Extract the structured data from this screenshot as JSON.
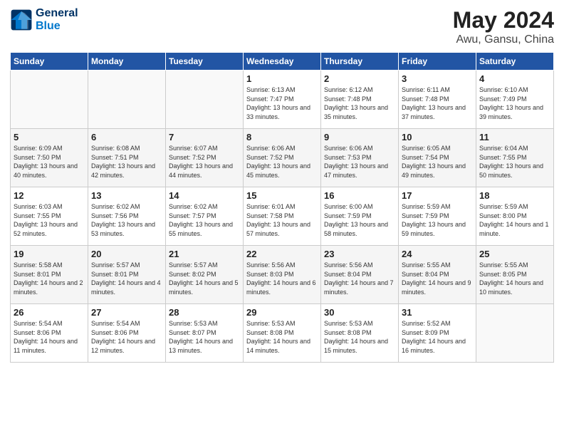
{
  "logo": {
    "line1": "General",
    "line2": "Blue"
  },
  "title": "May 2024",
  "subtitle": "Awu, Gansu, China",
  "days_of_week": [
    "Sunday",
    "Monday",
    "Tuesday",
    "Wednesday",
    "Thursday",
    "Friday",
    "Saturday"
  ],
  "weeks": [
    [
      {
        "num": "",
        "info": ""
      },
      {
        "num": "",
        "info": ""
      },
      {
        "num": "",
        "info": ""
      },
      {
        "num": "1",
        "info": "Sunrise: 6:13 AM\nSunset: 7:47 PM\nDaylight: 13 hours\nand 33 minutes."
      },
      {
        "num": "2",
        "info": "Sunrise: 6:12 AM\nSunset: 7:48 PM\nDaylight: 13 hours\nand 35 minutes."
      },
      {
        "num": "3",
        "info": "Sunrise: 6:11 AM\nSunset: 7:48 PM\nDaylight: 13 hours\nand 37 minutes."
      },
      {
        "num": "4",
        "info": "Sunrise: 6:10 AM\nSunset: 7:49 PM\nDaylight: 13 hours\nand 39 minutes."
      }
    ],
    [
      {
        "num": "5",
        "info": "Sunrise: 6:09 AM\nSunset: 7:50 PM\nDaylight: 13 hours\nand 40 minutes."
      },
      {
        "num": "6",
        "info": "Sunrise: 6:08 AM\nSunset: 7:51 PM\nDaylight: 13 hours\nand 42 minutes."
      },
      {
        "num": "7",
        "info": "Sunrise: 6:07 AM\nSunset: 7:52 PM\nDaylight: 13 hours\nand 44 minutes."
      },
      {
        "num": "8",
        "info": "Sunrise: 6:06 AM\nSunset: 7:52 PM\nDaylight: 13 hours\nand 45 minutes."
      },
      {
        "num": "9",
        "info": "Sunrise: 6:06 AM\nSunset: 7:53 PM\nDaylight: 13 hours\nand 47 minutes."
      },
      {
        "num": "10",
        "info": "Sunrise: 6:05 AM\nSunset: 7:54 PM\nDaylight: 13 hours\nand 49 minutes."
      },
      {
        "num": "11",
        "info": "Sunrise: 6:04 AM\nSunset: 7:55 PM\nDaylight: 13 hours\nand 50 minutes."
      }
    ],
    [
      {
        "num": "12",
        "info": "Sunrise: 6:03 AM\nSunset: 7:55 PM\nDaylight: 13 hours\nand 52 minutes."
      },
      {
        "num": "13",
        "info": "Sunrise: 6:02 AM\nSunset: 7:56 PM\nDaylight: 13 hours\nand 53 minutes."
      },
      {
        "num": "14",
        "info": "Sunrise: 6:02 AM\nSunset: 7:57 PM\nDaylight: 13 hours\nand 55 minutes."
      },
      {
        "num": "15",
        "info": "Sunrise: 6:01 AM\nSunset: 7:58 PM\nDaylight: 13 hours\nand 57 minutes."
      },
      {
        "num": "16",
        "info": "Sunrise: 6:00 AM\nSunset: 7:59 PM\nDaylight: 13 hours\nand 58 minutes."
      },
      {
        "num": "17",
        "info": "Sunrise: 5:59 AM\nSunset: 7:59 PM\nDaylight: 13 hours\nand 59 minutes."
      },
      {
        "num": "18",
        "info": "Sunrise: 5:59 AM\nSunset: 8:00 PM\nDaylight: 14 hours\nand 1 minute."
      }
    ],
    [
      {
        "num": "19",
        "info": "Sunrise: 5:58 AM\nSunset: 8:01 PM\nDaylight: 14 hours\nand 2 minutes."
      },
      {
        "num": "20",
        "info": "Sunrise: 5:57 AM\nSunset: 8:01 PM\nDaylight: 14 hours\nand 4 minutes."
      },
      {
        "num": "21",
        "info": "Sunrise: 5:57 AM\nSunset: 8:02 PM\nDaylight: 14 hours\nand 5 minutes."
      },
      {
        "num": "22",
        "info": "Sunrise: 5:56 AM\nSunset: 8:03 PM\nDaylight: 14 hours\nand 6 minutes."
      },
      {
        "num": "23",
        "info": "Sunrise: 5:56 AM\nSunset: 8:04 PM\nDaylight: 14 hours\nand 7 minutes."
      },
      {
        "num": "24",
        "info": "Sunrise: 5:55 AM\nSunset: 8:04 PM\nDaylight: 14 hours\nand 9 minutes."
      },
      {
        "num": "25",
        "info": "Sunrise: 5:55 AM\nSunset: 8:05 PM\nDaylight: 14 hours\nand 10 minutes."
      }
    ],
    [
      {
        "num": "26",
        "info": "Sunrise: 5:54 AM\nSunset: 8:06 PM\nDaylight: 14 hours\nand 11 minutes."
      },
      {
        "num": "27",
        "info": "Sunrise: 5:54 AM\nSunset: 8:06 PM\nDaylight: 14 hours\nand 12 minutes."
      },
      {
        "num": "28",
        "info": "Sunrise: 5:53 AM\nSunset: 8:07 PM\nDaylight: 14 hours\nand 13 minutes."
      },
      {
        "num": "29",
        "info": "Sunrise: 5:53 AM\nSunset: 8:08 PM\nDaylight: 14 hours\nand 14 minutes."
      },
      {
        "num": "30",
        "info": "Sunrise: 5:53 AM\nSunset: 8:08 PM\nDaylight: 14 hours\nand 15 minutes."
      },
      {
        "num": "31",
        "info": "Sunrise: 5:52 AM\nSunset: 8:09 PM\nDaylight: 14 hours\nand 16 minutes."
      },
      {
        "num": "",
        "info": ""
      }
    ]
  ]
}
